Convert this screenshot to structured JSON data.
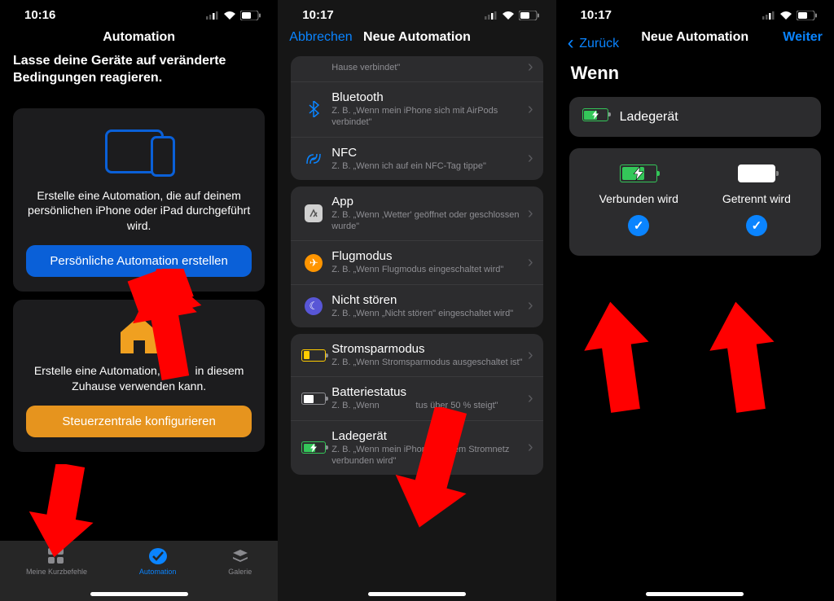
{
  "screen1": {
    "time": "10:16",
    "title": "Automation",
    "intro": "Lasse deine Geräte auf veränderte Bedingungen reagieren.",
    "personal_desc": "Erstelle eine Automation, die auf deinem persönlichen iPhone oder iPad durchgeführt wird.",
    "personal_button": "Persönliche Automation erstellen",
    "home_desc_a": "Erstelle eine Automation, ",
    "home_desc_b": " in diesem Zuhause verwenden kann.",
    "home_button": "Steuerzentrale konfigurieren",
    "tab1": "Meine Kurzbefehle",
    "tab2": "Automation",
    "tab3": "Galerie"
  },
  "screen2": {
    "time": "10:17",
    "cancel": "Abbrechen",
    "title": "Neue Automation",
    "stub_sub": "Hause verbindet\"",
    "rows": {
      "bluetooth": {
        "t": "Bluetooth",
        "s": "Z. B. „Wenn mein iPhone sich mit AirPods verbindet\""
      },
      "nfc": {
        "t": "NFC",
        "s": "Z. B. „Wenn ich auf ein NFC-Tag tippe\""
      },
      "app": {
        "t": "App",
        "s": "Z. B. „Wenn ‚Wetter' geöffnet oder geschlossen wurde\""
      },
      "flug": {
        "t": "Flugmodus",
        "s": "Z. B. „Wenn Flugmodus eingeschaltet wird\""
      },
      "dnd": {
        "t": "Nicht stören",
        "s": "Z. B. „Wenn „Nicht stören\" eingeschaltet wird\""
      },
      "lpm": {
        "t": "Stromsparmodus",
        "s": "Z. B. „Wenn Stromsparmodus ausgeschaltet ist\""
      },
      "bat": {
        "t": "Batteriestatus",
        "s_a": "Z. B. „Wenn",
        "s_b": "tus über 50 % steigt\""
      },
      "chg": {
        "t": "Ladegerät",
        "s": "Z. B. „Wenn mein iPhone mit dem Stromnetz verbunden wird\""
      }
    }
  },
  "screen3": {
    "time": "10:17",
    "back": "Zurück",
    "title": "Neue Automation",
    "next": "Weiter",
    "when": "Wenn",
    "charger": "Ladegerät",
    "connected": "Verbunden wird",
    "disconnected": "Getrennt wird"
  }
}
